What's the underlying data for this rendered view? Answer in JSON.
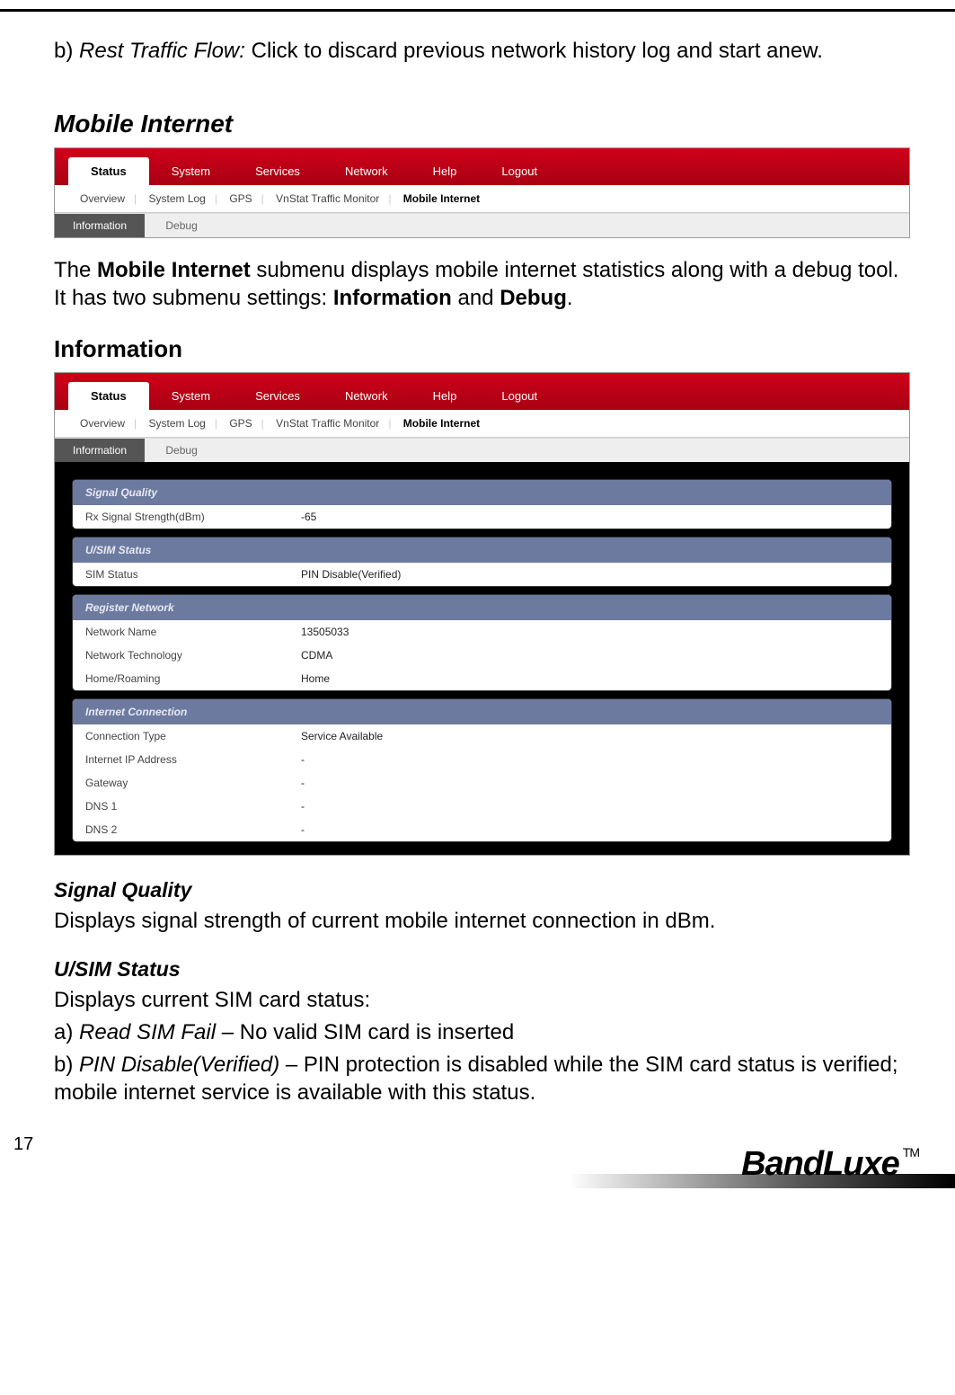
{
  "intro": {
    "prefix": "b) ",
    "italic": "Rest Traffic Flow:",
    "rest": " Click to discard previous network history log and start anew."
  },
  "section_mobile_internet": "Mobile Internet",
  "nav": {
    "tabs": [
      "Status",
      "System",
      "Services",
      "Network",
      "Help",
      "Logout"
    ],
    "sub": [
      "Overview",
      "System Log",
      "GPS",
      "VnStat Traffic Monitor",
      "Mobile Internet"
    ],
    "third": [
      "Information",
      "Debug"
    ]
  },
  "para_mi_1a": "The ",
  "para_mi_1b": "Mobile Internet",
  "para_mi_1c": " submenu displays mobile internet statistics along with a debug tool. It has two submenu settings: ",
  "para_mi_1d": "Information",
  "para_mi_1e": " and ",
  "para_mi_1f": "Debug",
  "para_mi_1g": ".",
  "h3_information": "Information",
  "panels": {
    "signal": {
      "title": "Signal Quality",
      "rows": [
        {
          "label": "Rx Signal Strength(dBm)",
          "value": "-65"
        }
      ]
    },
    "sim": {
      "title": "U/SIM Status",
      "rows": [
        {
          "label": "SIM Status",
          "value": "PIN Disable(Verified)"
        }
      ]
    },
    "register": {
      "title": "Register Network",
      "rows": [
        {
          "label": "Network Name",
          "value": "13505033"
        },
        {
          "label": "Network Technology",
          "value": "CDMA"
        },
        {
          "label": "Home/Roaming",
          "value": "Home"
        }
      ]
    },
    "internet": {
      "title": "Internet Connection",
      "rows": [
        {
          "label": "Connection Type",
          "value": "Service Available"
        },
        {
          "label": "Internet IP Address",
          "value": "-"
        },
        {
          "label": "Gateway",
          "value": "-"
        },
        {
          "label": "DNS 1",
          "value": "-"
        },
        {
          "label": "DNS 2",
          "value": "-"
        }
      ]
    }
  },
  "h4_signal": "Signal Quality",
  "p_signal": "Displays signal strength of current mobile internet connection in dBm.",
  "h4_sim": "U/SIM Status",
  "p_sim": "Displays current SIM card status:",
  "p_sim_a_pre": "a) ",
  "p_sim_a_it": "Read SIM Fail",
  "p_sim_a_post": " – No valid SIM card is inserted",
  "p_sim_b_pre": "b) ",
  "p_sim_b_it": "PIN Disable(Verified)",
  "p_sim_b_post": " – PIN protection is disabled while the SIM card status is verified; mobile internet service is available with this status.",
  "page_number": "17",
  "brand": "BandLuxe",
  "tm": "TM"
}
